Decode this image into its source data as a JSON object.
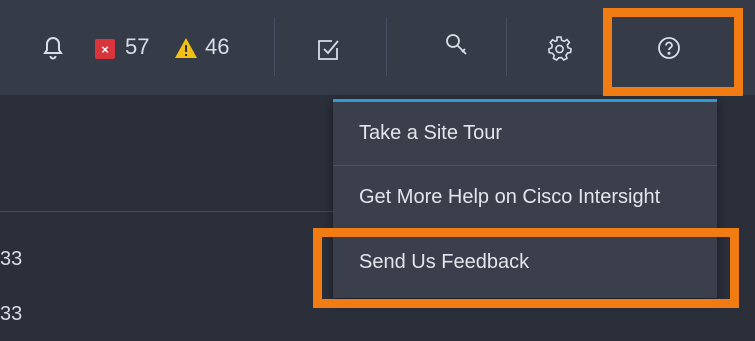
{
  "topbar": {
    "error_count": "57",
    "warning_count": "46",
    "error_badge_glyph": "×",
    "icons": [
      "bell-icon",
      "error-icon",
      "warning-icon",
      "tasks-icon",
      "search-icon",
      "settings-icon",
      "help-icon"
    ]
  },
  "background_rows": [
    "33",
    "33"
  ],
  "help_menu": {
    "items": [
      "Take a Site Tour",
      "Get More Help on Cisco Intersight",
      "Send Us Feedback"
    ]
  },
  "colors": {
    "highlight": "#f07c13",
    "menu_accent": "#2f9ad6",
    "error": "#d8343b",
    "warning": "#f2c012"
  }
}
